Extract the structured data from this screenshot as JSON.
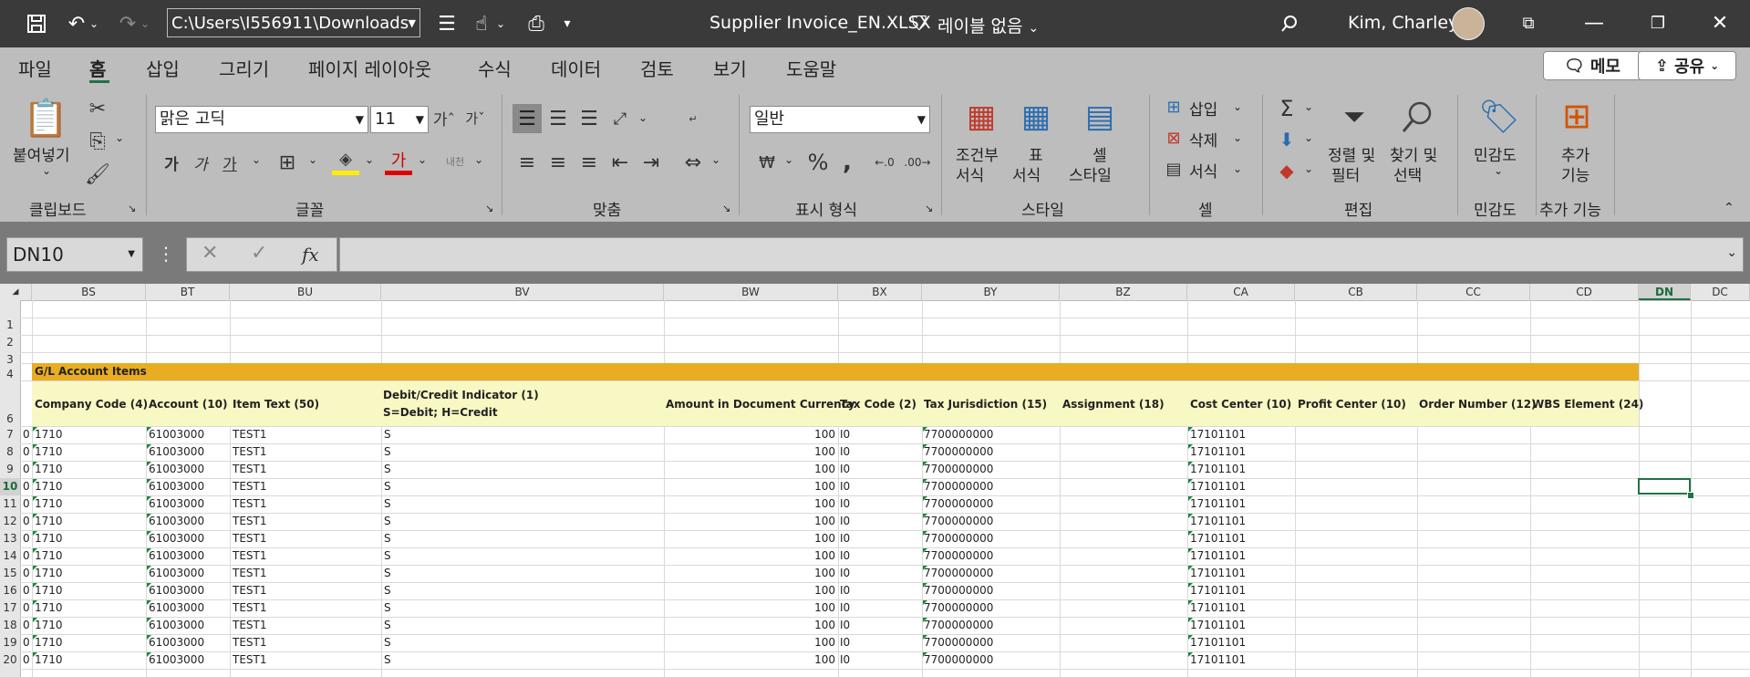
{
  "titlebar": {
    "path": "C:\\Users\\I556911\\Downloads",
    "document_title": "Supplier Invoice_EN.XLSX",
    "label": "레이블 없음",
    "user": "Kim, Charley"
  },
  "menu": {
    "tabs": [
      "파일",
      "홈",
      "삽입",
      "그리기",
      "페이지 레이아웃",
      "수식",
      "데이터",
      "검토",
      "보기",
      "도움말"
    ],
    "active": "홈",
    "memo_button": "메모",
    "share_button": "공유"
  },
  "ribbon": {
    "clipboard": {
      "paste": "붙여넣기",
      "group": "클립보드"
    },
    "font": {
      "name": "맑은 고딕",
      "size": "11",
      "group": "글꼴"
    },
    "alignment": {
      "group": "맞춤"
    },
    "number": {
      "format": "일반",
      "group": "표시 형식"
    },
    "styles": {
      "conditional_1": "조건부",
      "conditional_2": "서식",
      "table_1": "표",
      "table_2": "서식",
      "cell_1": "셀",
      "cell_2": "스타일",
      "group": "스타일"
    },
    "cells": {
      "insert": "삽입",
      "delete": "삭제",
      "format": "서식",
      "group": "셀"
    },
    "editing": {
      "sort_1": "정렬 및",
      "sort_2": "필터",
      "find_1": "찾기 및",
      "find_2": "선택",
      "group": "편집"
    },
    "sensitivity": {
      "label": "민감도",
      "group": "민감도"
    },
    "addins": {
      "label_1": "추가",
      "label_2": "기능",
      "group": "추가 기능"
    }
  },
  "formula_bar": {
    "name_box": "DN10",
    "fx": "fx",
    "value": ""
  },
  "grid": {
    "columns": [
      "BS",
      "BT",
      "BU",
      "BV",
      "BW",
      "BX",
      "BY",
      "BZ",
      "CA",
      "CB",
      "CC",
      "CD",
      "DN",
      "DC"
    ],
    "selected_column": "DN",
    "selected_row": "10",
    "rows": [
      "1",
      "2",
      "3",
      "4",
      "6",
      "7",
      "8",
      "9",
      "10",
      "11",
      "12",
      "13",
      "14",
      "15",
      "16",
      "17",
      "18",
      "19",
      "20"
    ],
    "section_title": "G/L Account Items",
    "headers": {
      "company_code": "Company Code (4)",
      "account": "Account (10)",
      "item_text": "Item Text (50)",
      "dc_line1": "Debit/Credit Indicator (1)",
      "dc_line2": "S=Debit; H=Credit",
      "amount": "Amount in Document Currency",
      "tax_code": "Tax Code (2)",
      "tax_jurisdiction": "Tax Jurisdiction (15)",
      "assignment": "Assignment (18)",
      "cost_center": "Cost Center (10)",
      "profit_center": "Profit Center (10)",
      "order_number": "Order Number (12)",
      "wbs_element": "WBS Element (24)"
    },
    "data_rows": [
      {
        "row": "7",
        "lead": "0",
        "company_code": "1710",
        "account": "61003000",
        "item_text": "TEST1",
        "dc": "S",
        "amount": "100",
        "tax_code": "I0",
        "tax_jurisdiction": "7700000000",
        "cost_center": "17101101"
      },
      {
        "row": "8",
        "lead": "0",
        "company_code": "1710",
        "account": "61003000",
        "item_text": "TEST1",
        "dc": "S",
        "amount": "100",
        "tax_code": "I0",
        "tax_jurisdiction": "7700000000",
        "cost_center": "17101101"
      },
      {
        "row": "9",
        "lead": "0",
        "company_code": "1710",
        "account": "61003000",
        "item_text": "TEST1",
        "dc": "S",
        "amount": "100",
        "tax_code": "I0",
        "tax_jurisdiction": "7700000000",
        "cost_center": "17101101"
      },
      {
        "row": "10",
        "lead": "0",
        "company_code": "1710",
        "account": "61003000",
        "item_text": "TEST1",
        "dc": "S",
        "amount": "100",
        "tax_code": "I0",
        "tax_jurisdiction": "7700000000",
        "cost_center": "17101101"
      },
      {
        "row": "11",
        "lead": "0",
        "company_code": "1710",
        "account": "61003000",
        "item_text": "TEST1",
        "dc": "S",
        "amount": "100",
        "tax_code": "I0",
        "tax_jurisdiction": "7700000000",
        "cost_center": "17101101"
      },
      {
        "row": "12",
        "lead": "0",
        "company_code": "1710",
        "account": "61003000",
        "item_text": "TEST1",
        "dc": "S",
        "amount": "100",
        "tax_code": "I0",
        "tax_jurisdiction": "7700000000",
        "cost_center": "17101101"
      },
      {
        "row": "13",
        "lead": "0",
        "company_code": "1710",
        "account": "61003000",
        "item_text": "TEST1",
        "dc": "S",
        "amount": "100",
        "tax_code": "I0",
        "tax_jurisdiction": "7700000000",
        "cost_center": "17101101"
      },
      {
        "row": "14",
        "lead": "0",
        "company_code": "1710",
        "account": "61003000",
        "item_text": "TEST1",
        "dc": "S",
        "amount": "100",
        "tax_code": "I0",
        "tax_jurisdiction": "7700000000",
        "cost_center": "17101101"
      },
      {
        "row": "15",
        "lead": "0",
        "company_code": "1710",
        "account": "61003000",
        "item_text": "TEST1",
        "dc": "S",
        "amount": "100",
        "tax_code": "I0",
        "tax_jurisdiction": "7700000000",
        "cost_center": "17101101"
      },
      {
        "row": "16",
        "lead": "0",
        "company_code": "1710",
        "account": "61003000",
        "item_text": "TEST1",
        "dc": "S",
        "amount": "100",
        "tax_code": "I0",
        "tax_jurisdiction": "7700000000",
        "cost_center": "17101101"
      },
      {
        "row": "17",
        "lead": "0",
        "company_code": "1710",
        "account": "61003000",
        "item_text": "TEST1",
        "dc": "S",
        "amount": "100",
        "tax_code": "I0",
        "tax_jurisdiction": "7700000000",
        "cost_center": "17101101"
      },
      {
        "row": "18",
        "lead": "0",
        "company_code": "1710",
        "account": "61003000",
        "item_text": "TEST1",
        "dc": "S",
        "amount": "100",
        "tax_code": "I0",
        "tax_jurisdiction": "7700000000",
        "cost_center": "17101101"
      },
      {
        "row": "19",
        "lead": "0",
        "company_code": "1710",
        "account": "61003000",
        "item_text": "TEST1",
        "dc": "S",
        "amount": "100",
        "tax_code": "I0",
        "tax_jurisdiction": "7700000000",
        "cost_center": "17101101"
      },
      {
        "row": "20",
        "lead": "0",
        "company_code": "1710",
        "account": "61003000",
        "item_text": "TEST1",
        "dc": "S",
        "amount": "100",
        "tax_code": "I0",
        "tax_jurisdiction": "7700000000",
        "cost_center": "17101101"
      }
    ]
  },
  "colors": {
    "title_bar": "#3a3a3a",
    "ribbon": "#bdbdbd",
    "section_band": "#e9ad22",
    "header_band": "#f8f8c4",
    "excel_green": "#217346"
  }
}
